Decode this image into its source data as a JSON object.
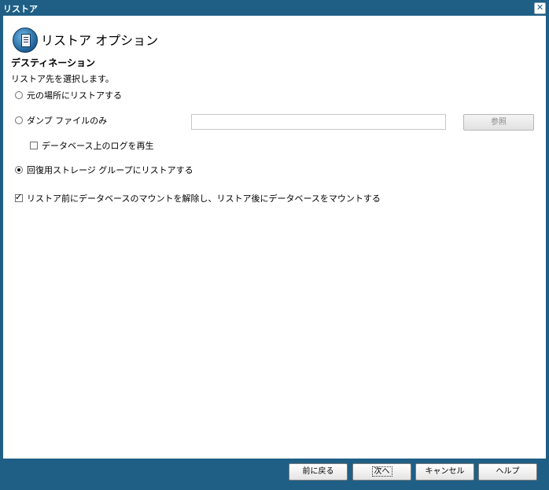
{
  "window": {
    "title": "リストア",
    "close_symbol": "✕"
  },
  "header": {
    "title": "リストア オプション",
    "icon": "restore-document-icon"
  },
  "destination": {
    "title": "デスティネーション",
    "description": "リストア先を選択します。",
    "options": {
      "original": {
        "label": "元の場所にリストアする",
        "selected": false
      },
      "dump": {
        "label": "ダンプ ファイルのみ",
        "selected": false,
        "input_value": "",
        "browse_label": "参照"
      },
      "replay_log": {
        "label": "データベース上のログを再生",
        "checked": false
      },
      "recovery": {
        "label": "回復用ストレージ グループにリストアする",
        "selected": true
      }
    },
    "mount_option": {
      "label": "リストア前にデータベースのマウントを解除し、リストア後にデータベースをマウントする",
      "checked": true
    }
  },
  "footer": {
    "back_label": "前に戻る",
    "next_label": "次へ",
    "cancel_label": "キャンセル",
    "help_label": "ヘルプ"
  },
  "colors": {
    "frame": "#1f5f86",
    "content_bg": "#ffffff"
  }
}
